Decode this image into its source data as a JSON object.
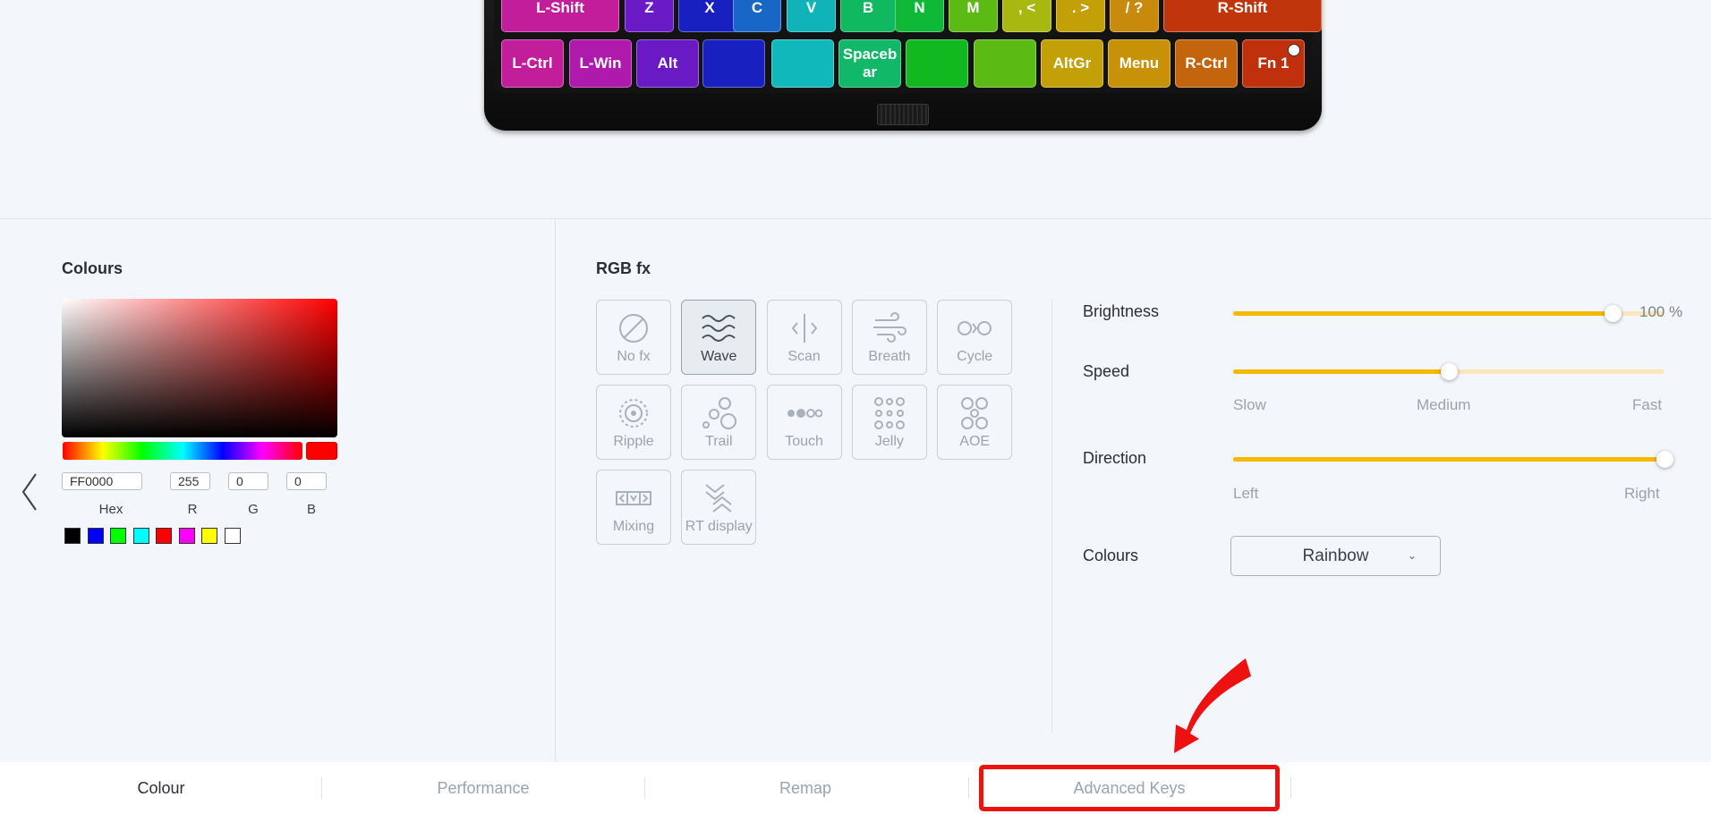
{
  "keyboard": {
    "row1": [
      {
        "label": "L-Shift",
        "color": "#c21e9c"
      },
      {
        "label": "Z",
        "color": "#6a1ac4"
      },
      {
        "label": "X",
        "color": "#1820c0"
      },
      {
        "label": "C",
        "color": "#1866c6"
      },
      {
        "label": "V",
        "color": "#10b4b8"
      },
      {
        "label": "B",
        "color": "#10b860"
      },
      {
        "label": "N",
        "color": "#10b838"
      },
      {
        "label": "M",
        "color": "#5cba14"
      },
      {
        "label": ", <",
        "color": "#a8b810"
      },
      {
        "label": ". >",
        "color": "#c4a008"
      },
      {
        "label": "/ ?",
        "color": "#c88a0c"
      },
      {
        "label": "R-Shift",
        "color": "#c0350c"
      }
    ],
    "row2": [
      {
        "label": "L-Ctrl",
        "color": "#c21e9c"
      },
      {
        "label": "L-Win",
        "color": "#b01aac"
      },
      {
        "label": "Alt",
        "color": "#6a1ac4"
      },
      {
        "label": "",
        "color": "#1820c0"
      },
      {
        "label": "",
        "color": "#10b8bc"
      },
      {
        "label": "Spacebar",
        "color": "#10b868"
      },
      {
        "label": "",
        "color": "#12b820"
      },
      {
        "label": "",
        "color": "#5cba14"
      },
      {
        "label": "AltGr",
        "color": "#c4a008"
      },
      {
        "label": "Menu",
        "color": "#c89208"
      },
      {
        "label": "R-Ctrl",
        "color": "#c4640c"
      },
      {
        "label": "Fn 1",
        "color": "#c0300c"
      }
    ]
  },
  "colours": {
    "title": "Colours",
    "hex": "FF0000",
    "r": "255",
    "g": "0",
    "b": "0",
    "labels": {
      "hex": "Hex",
      "r": "R",
      "g": "G",
      "b": "B"
    },
    "current_color": "#ff0000",
    "swatches": [
      "#000000",
      "#0000ff",
      "#00ff00",
      "#00ffff",
      "#ff0000",
      "#ff00ff",
      "#ffff00",
      "#ffffff"
    ]
  },
  "rgbfx": {
    "title": "RGB fx",
    "selected": "Wave",
    "effects": [
      {
        "label": "No fx",
        "icon": "no-fx-icon"
      },
      {
        "label": "Wave",
        "icon": "wave-icon"
      },
      {
        "label": "Scan",
        "icon": "scan-icon"
      },
      {
        "label": "Breath",
        "icon": "breath-icon"
      },
      {
        "label": "Cycle",
        "icon": "cycle-icon"
      },
      {
        "label": "Ripple",
        "icon": "ripple-icon"
      },
      {
        "label": "Trail",
        "icon": "trail-icon"
      },
      {
        "label": "Touch",
        "icon": "touch-icon"
      },
      {
        "label": "Jelly",
        "icon": "jelly-icon"
      },
      {
        "label": "AOE",
        "icon": "aoe-icon"
      },
      {
        "label": "Mixing",
        "icon": "mixing-icon"
      },
      {
        "label": "RT display",
        "icon": "rt-display-icon"
      }
    ]
  },
  "settings": {
    "brightness": {
      "label": "Brightness",
      "value": 100,
      "value_text": "100 %"
    },
    "speed": {
      "label": "Speed",
      "value": 0.5,
      "ticks": [
        "Slow",
        "Medium",
        "Fast"
      ]
    },
    "direction": {
      "label": "Direction",
      "value": 1,
      "ticks": [
        "Left",
        "Right"
      ]
    },
    "colours": {
      "label": "Colours",
      "selected": "Rainbow"
    },
    "accent_color": "#f5b700"
  },
  "nav": {
    "tabs": [
      "Colour",
      "Performance",
      "Remap",
      "Advanced Keys"
    ],
    "active": "Colour",
    "highlighted": "Advanced Keys"
  }
}
